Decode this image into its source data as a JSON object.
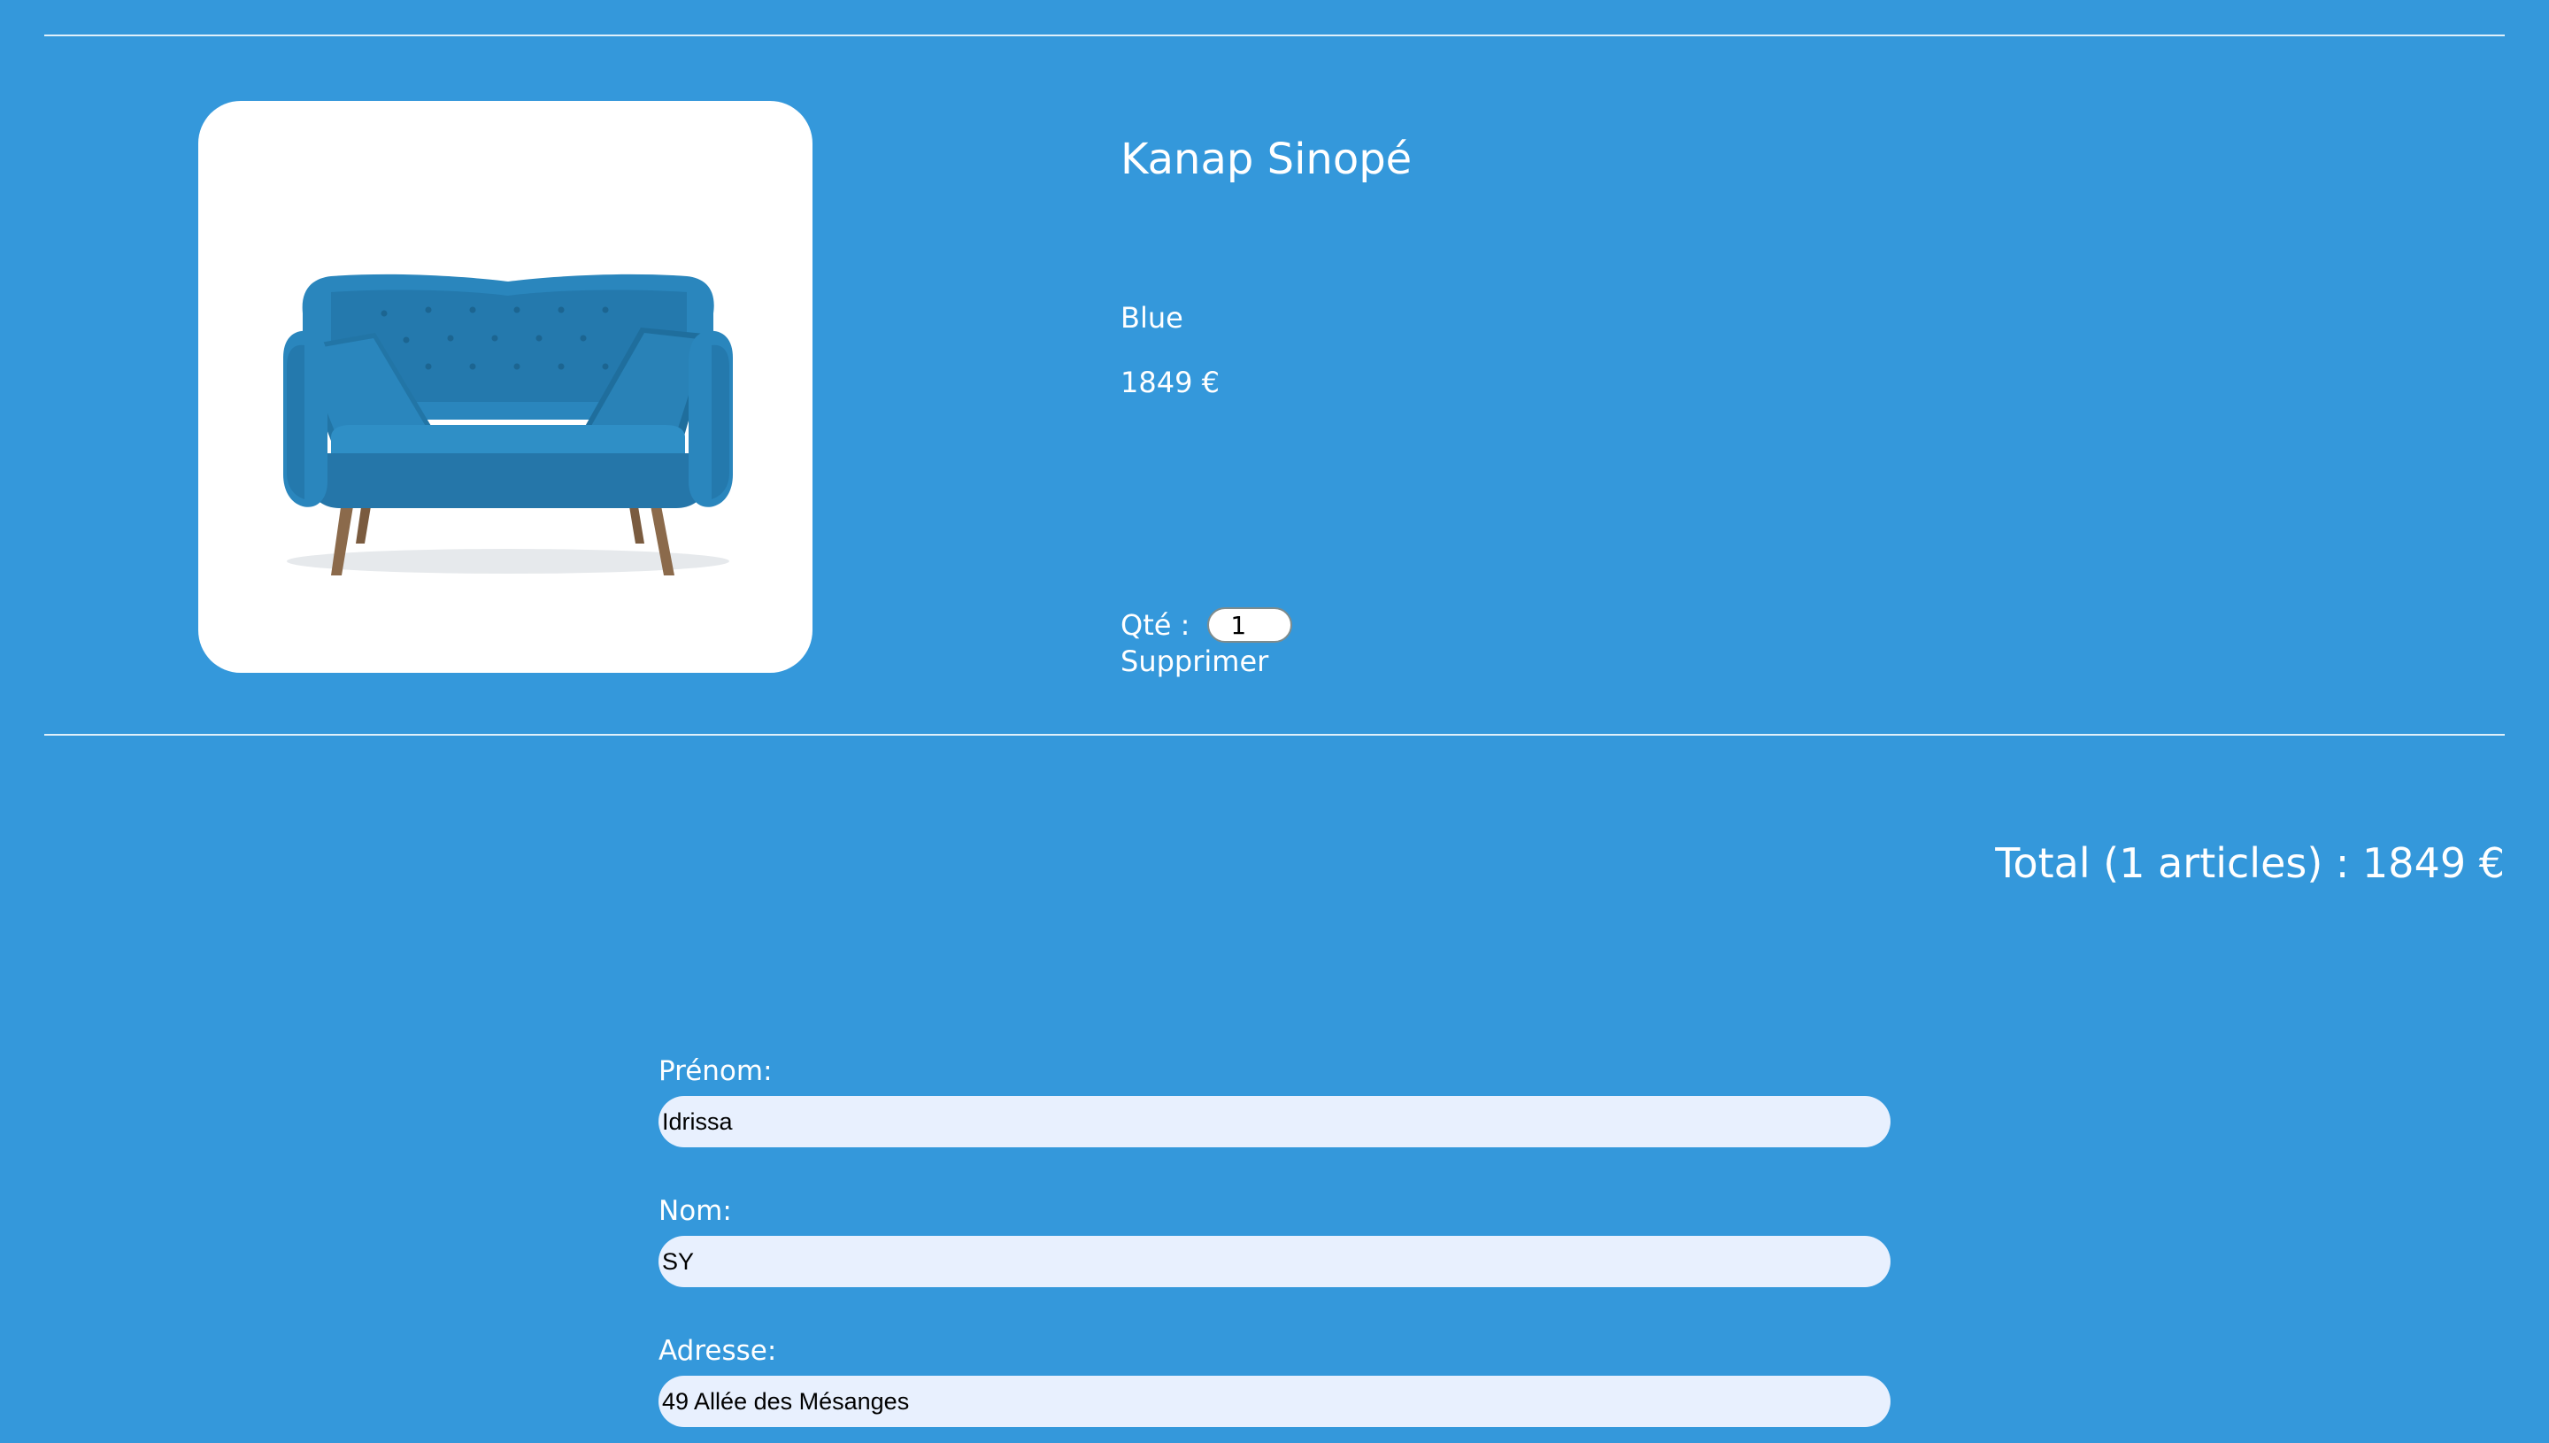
{
  "cart_item": {
    "image_alt": "Kanap Sinopé - blue two-seat sofa",
    "name": "Kanap Sinopé",
    "color": "Blue",
    "price": "1849 €",
    "quantity_label": "Qté :",
    "quantity_value": "1",
    "delete_label": "Supprimer"
  },
  "total": {
    "text": "Total (1 articles) : 1849 €"
  },
  "order_form": {
    "first_name_label": "Prénom:",
    "first_name_value": "Idrissa",
    "last_name_label": "Nom:",
    "last_name_value": "SY",
    "address_label": "Adresse:",
    "address_value": "49 Allée des Mésanges"
  },
  "colors": {
    "background": "#3498db",
    "card": "#ffffff",
    "input_fill": "#e8f0fe",
    "sofa": "#2a86bd"
  }
}
